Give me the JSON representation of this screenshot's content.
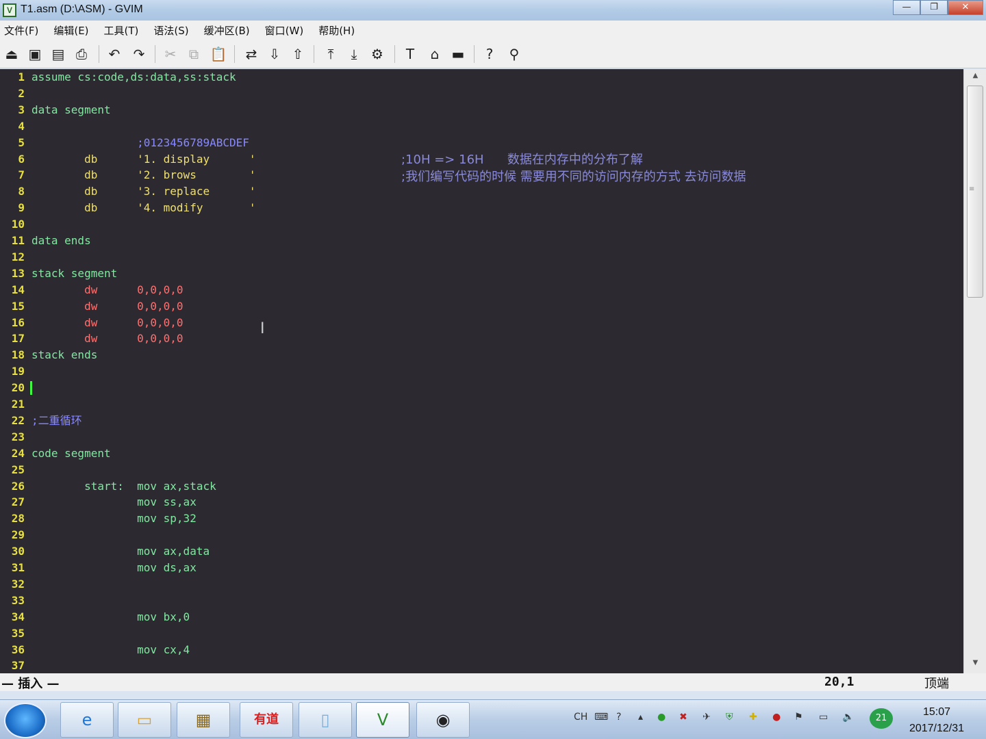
{
  "window": {
    "title": "T1.asm (D:\\ASM) - GVIM",
    "app_icon_label": "V",
    "buttons": [
      "—",
      "❐",
      "✕"
    ]
  },
  "menu": [
    "文件(F)",
    "编辑(E)",
    "工具(T)",
    "语法(S)",
    "缓冲区(B)",
    "窗口(W)",
    "帮助(H)"
  ],
  "toolbar_icons": [
    {
      "name": "open-icon",
      "glyph": "⏏"
    },
    {
      "name": "save-icon",
      "glyph": "▣"
    },
    {
      "name": "save-all-icon",
      "glyph": "▤"
    },
    {
      "name": "print-icon",
      "glyph": "⎙"
    },
    {
      "name": "undo-icon",
      "glyph": "↶"
    },
    {
      "name": "redo-icon",
      "glyph": "↷"
    },
    {
      "name": "cut-icon",
      "glyph": "✂"
    },
    {
      "name": "copy-icon",
      "glyph": "⧉"
    },
    {
      "name": "paste-icon",
      "glyph": "📋"
    },
    {
      "name": "replace-icon",
      "glyph": "⇄"
    },
    {
      "name": "find-next-icon",
      "glyph": "⇩"
    },
    {
      "name": "find-prev-icon",
      "glyph": "⇧"
    },
    {
      "name": "load-session-icon",
      "glyph": "⤒"
    },
    {
      "name": "save-session-icon",
      "glyph": "⤓"
    },
    {
      "name": "run-script-icon",
      "glyph": "⚙"
    },
    {
      "name": "make-icon",
      "glyph": "T"
    },
    {
      "name": "shell-icon",
      "glyph": "⌂"
    },
    {
      "name": "tag-icon",
      "glyph": "▬"
    },
    {
      "name": "help-icon",
      "glyph": "?"
    },
    {
      "name": "find-help-icon",
      "glyph": "⚲"
    }
  ],
  "editor": {
    "lines": [
      {
        "n": "1",
        "code": "assume cs:code,ds:data,ss:stack"
      },
      {
        "n": "2",
        "code": ""
      },
      {
        "n": "3",
        "code": "data segment"
      },
      {
        "n": "4",
        "code": ""
      },
      {
        "n": "5",
        "code": "                ;0123456789ABCDEF"
      },
      {
        "n": "6",
        "code": "        db      '1. display      '"
      },
      {
        "n": "7",
        "code": "        db      '2. brows        '"
      },
      {
        "n": "8",
        "code": "        db      '3. replace      '"
      },
      {
        "n": "9",
        "code": "        db      '4. modify       '"
      },
      {
        "n": "10",
        "code": ""
      },
      {
        "n": "11",
        "code": "data ends"
      },
      {
        "n": "12",
        "code": ""
      },
      {
        "n": "13",
        "code": "stack segment"
      },
      {
        "n": "14",
        "code": "        dw      0,0,0,0"
      },
      {
        "n": "15",
        "code": "        dw      0,0,0,0"
      },
      {
        "n": "16",
        "code": "        dw      0,0,0,0"
      },
      {
        "n": "17",
        "code": "        dw      0,0,0,0"
      },
      {
        "n": "18",
        "code": "stack ends"
      },
      {
        "n": "19",
        "code": ""
      },
      {
        "n": "20",
        "code": ""
      },
      {
        "n": "21",
        "code": ""
      },
      {
        "n": "22",
        "code": ";二重循环"
      },
      {
        "n": "23",
        "code": ""
      },
      {
        "n": "24",
        "code": "code segment"
      },
      {
        "n": "25",
        "code": ""
      },
      {
        "n": "26",
        "code": "        start:  mov ax,stack"
      },
      {
        "n": "27",
        "code": "                mov ss,ax"
      },
      {
        "n": "28",
        "code": "                mov sp,32"
      },
      {
        "n": "29",
        "code": ""
      },
      {
        "n": "30",
        "code": "                mov ax,data"
      },
      {
        "n": "31",
        "code": "                mov ds,ax"
      },
      {
        "n": "32",
        "code": ""
      },
      {
        "n": "33",
        "code": ""
      },
      {
        "n": "34",
        "code": "                mov bx,0"
      },
      {
        "n": "35",
        "code": ""
      },
      {
        "n": "36",
        "code": "                mov cx,4"
      },
      {
        "n": "37",
        "code": ""
      }
    ],
    "annotation_line1": ";10H => 16H      数据在内存中的分布了解",
    "annotation_line2": ";我们编写代码的时候 需要用不同的访问内存的方式 去访问数据",
    "scroll_top_arrow": "▲",
    "scroll_bottom_arrow": "▼",
    "scroll_grip": "≡"
  },
  "status": {
    "mode": "— 插入 —",
    "position": "20,1",
    "scroll": "顶端"
  },
  "taskbar": {
    "apps": [
      {
        "name": "ie-taskbar-button",
        "glyph": "e",
        "color": "#1e78d8"
      },
      {
        "name": "explorer-taskbar-button",
        "glyph": "▭",
        "color": "#d8a030"
      },
      {
        "name": "app-taskbar-button",
        "glyph": "▦",
        "color": "#8a6a20"
      },
      {
        "name": "youdao-taskbar-button",
        "glyph": "有道",
        "color": "#d82020"
      },
      {
        "name": "folder-taskbar-button",
        "glyph": "▯",
        "color": "#7fb0d8"
      },
      {
        "name": "gvim-taskbar-button",
        "glyph": "V",
        "color": "#2a8a2a"
      },
      {
        "name": "obs-taskbar-button",
        "glyph": "◉",
        "color": "#222222"
      }
    ],
    "tray_lang": "CH",
    "clock_time": "15:07",
    "clock_date": "2017/12/31"
  }
}
